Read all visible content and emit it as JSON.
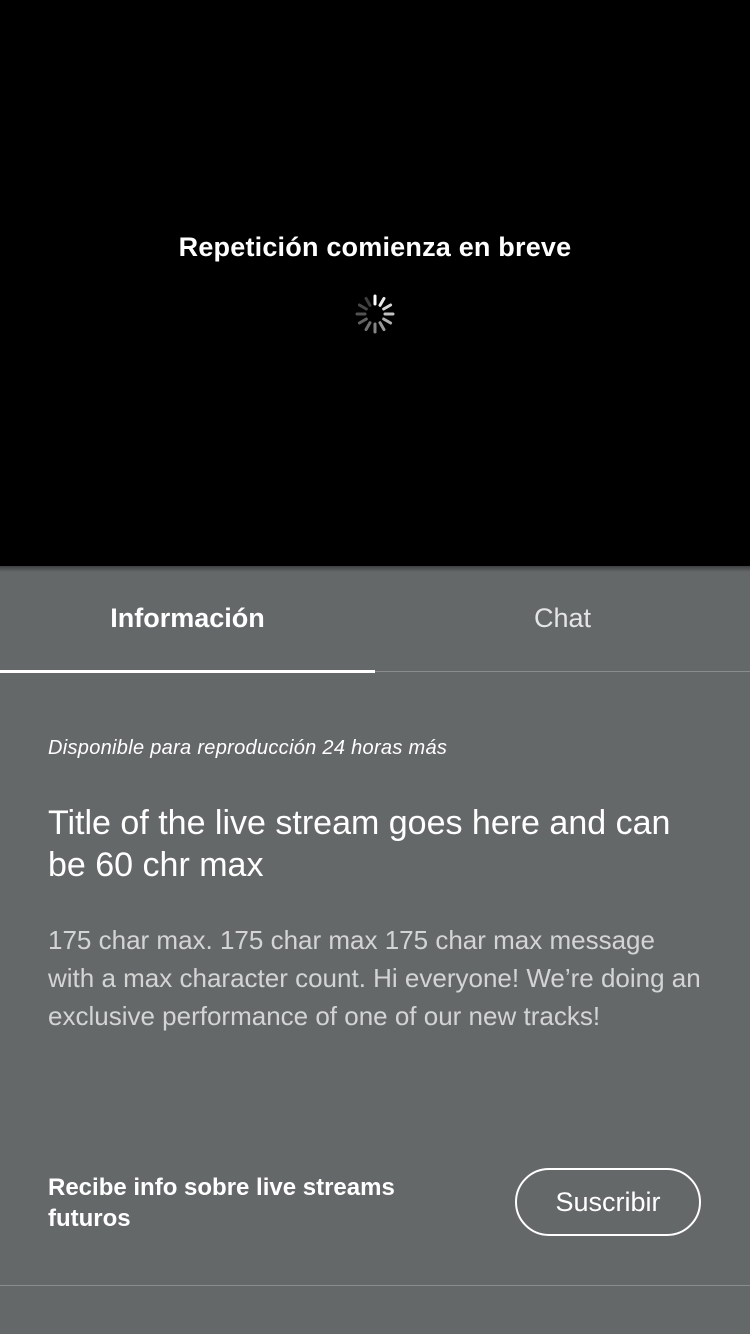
{
  "player": {
    "status_text": "Repetición comienza en breve",
    "spinner_icon": "loading-spinner-icon"
  },
  "tabs": [
    {
      "label": "Información",
      "selected": true
    },
    {
      "label": "Chat",
      "selected": false
    }
  ],
  "info": {
    "availability": "Disponible para reproducción 24 horas más",
    "title": "Title of the live stream goes here and can be 60 chr max",
    "description": "175 char max. 175 char max 175 char max message with a max character count. Hi everyone! We’re doing an exclusive performance of one of our new tracks!"
  },
  "subscribe": {
    "prompt": "Recibe info sobre live streams futuros",
    "button_label": "Suscribir"
  },
  "colors": {
    "player_background": "#000000",
    "panel_background": "#656869",
    "text_primary": "#ffffff"
  }
}
